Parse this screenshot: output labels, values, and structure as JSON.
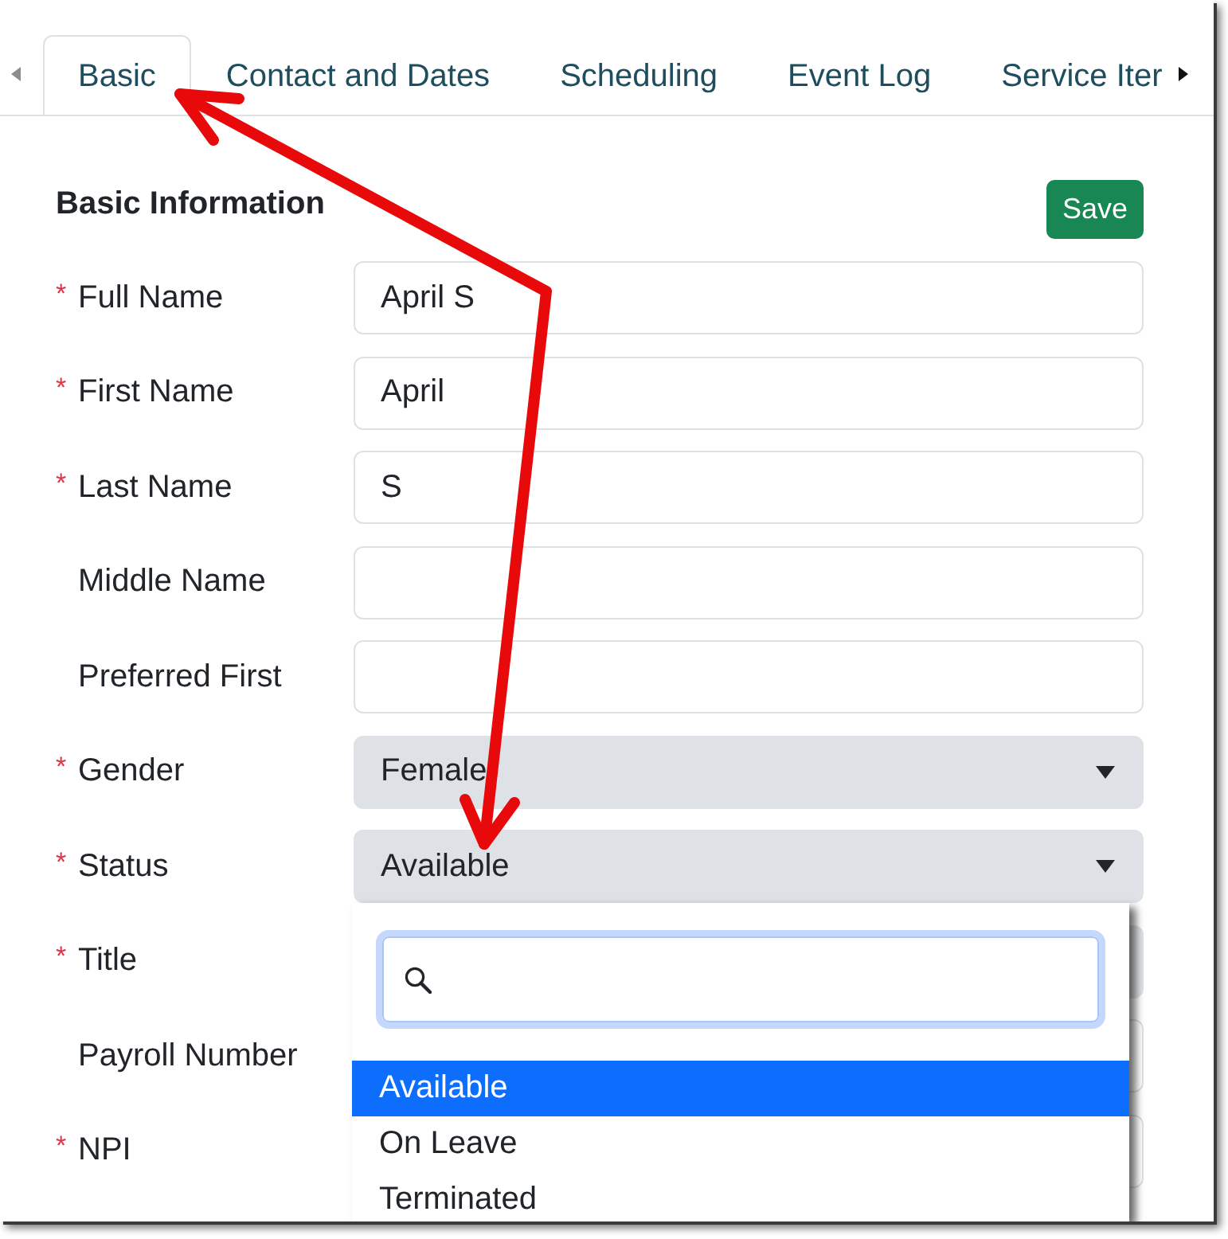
{
  "tabs": {
    "scroll_left": {
      "disabled": true
    },
    "items": [
      {
        "label": "Basic",
        "selected": true
      },
      {
        "label": "Contact and Dates",
        "selected": false
      },
      {
        "label": "Scheduling",
        "selected": false
      },
      {
        "label": "Event Log",
        "selected": false
      },
      {
        "label": "Service Iter",
        "selected": false
      }
    ],
    "scroll_right": {
      "disabled": false
    }
  },
  "section": {
    "title": "Basic Information",
    "save_button": "Save"
  },
  "fields": [
    {
      "label": "Full Name",
      "required_mark": "*",
      "kind": "text",
      "value": "April S"
    },
    {
      "label": "First Name",
      "required_mark": "*",
      "kind": "text",
      "value": "April"
    },
    {
      "label": "Last Name",
      "required_mark": "*",
      "kind": "text",
      "value": "S"
    },
    {
      "label": "Middle Name",
      "kind": "text"
    },
    {
      "label": "Preferred First",
      "kind": "text"
    },
    {
      "label": "Gender",
      "required_mark": "*",
      "kind": "select",
      "value": "Female"
    },
    {
      "label": "Status",
      "required_mark": "*",
      "kind": "select",
      "value": "Available",
      "dropdown": {
        "search": {
          "focused": true
        },
        "options": [
          {
            "label": "Available",
            "selected": true
          },
          {
            "label": "On Leave",
            "selected": false
          },
          {
            "label": "Terminated",
            "selected": false
          }
        ]
      }
    },
    {
      "label": "Title",
      "required_mark": "*",
      "kind": "select"
    },
    {
      "label": "Payroll Number",
      "kind": "text"
    },
    {
      "label": "NPI",
      "required_mark": "*",
      "kind": "text"
    }
  ]
}
